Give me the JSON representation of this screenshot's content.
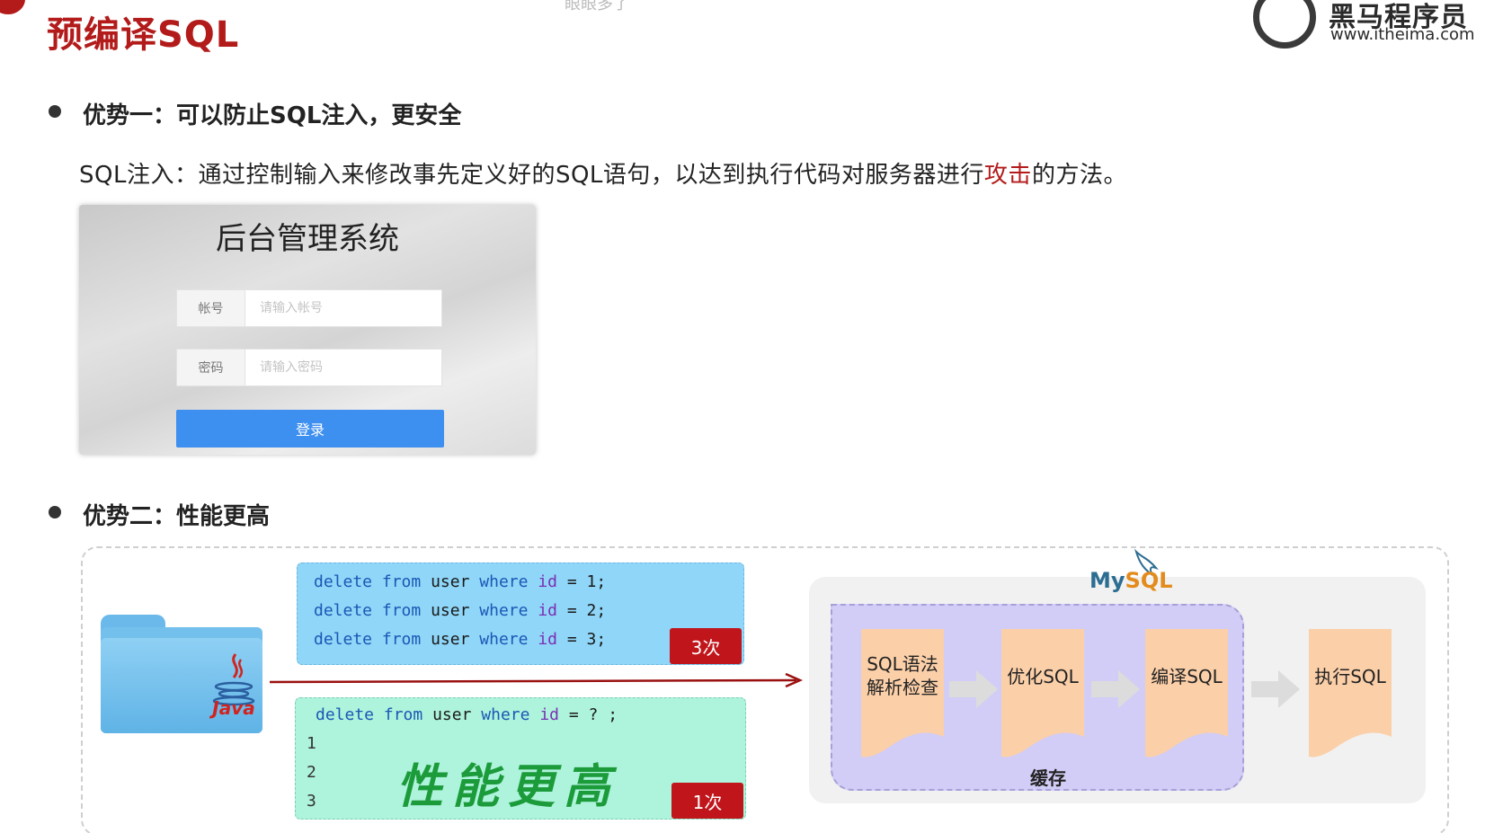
{
  "header": {
    "title": "预编译SQL",
    "top_mark": "眼眼多了",
    "logo_cn": "黑马程序员",
    "logo_url": "www.itheima.com"
  },
  "advantage1": {
    "heading": "优势一：可以防止SQL注入，更安全",
    "desc_before": "SQL注入：通过控制输入来修改事先定义好的SQL语句，以达到执行代码对服务器进行",
    "desc_highlight": "攻击",
    "desc_after": "的方法。"
  },
  "login": {
    "title": "后台管理系统",
    "account_label": "帐号",
    "account_placeholder": "请输入帐号",
    "password_label": "密码",
    "password_placeholder": "请输入密码",
    "submit_label": "登录"
  },
  "advantage2": {
    "heading": "优势二：性能更高"
  },
  "diagram": {
    "java_label": "Java",
    "statements": [
      {
        "kw1": "delete",
        "kw2": "from",
        "t1": "user",
        "kw3": "where",
        "t2": "id",
        "rest": "= 1;"
      },
      {
        "kw1": "delete",
        "kw2": "from",
        "t1": "user",
        "kw3": "where",
        "t2": "id",
        "rest": "= 2;"
      },
      {
        "kw1": "delete",
        "kw2": "from",
        "t1": "user",
        "kw3": "where",
        "t2": "id",
        "rest": "= 3;"
      }
    ],
    "badge_many": "3次",
    "prepared": {
      "kw1": "delete",
      "kw2": "from",
      "t1": "user",
      "kw3": "where",
      "t2": "id",
      "rest": "= ? ;"
    },
    "line_numbers": [
      "1",
      "2",
      "3"
    ],
    "perf_text": "性能更高",
    "badge_once": "1次",
    "mysql_my": "My",
    "mysql_sql": "SQL",
    "steps": [
      "SQL语法\n解析检查",
      "优化SQL",
      "编译SQL",
      "执行SQL"
    ],
    "cache_label": "缓存",
    "colors": {
      "accent_red": "#b31b1b",
      "blue_box": "#8fd6f8",
      "green_box": "#aef3dc",
      "cache": "#d2cdf6",
      "step": "#fbcfa8",
      "arrow": "#9a1010"
    }
  }
}
